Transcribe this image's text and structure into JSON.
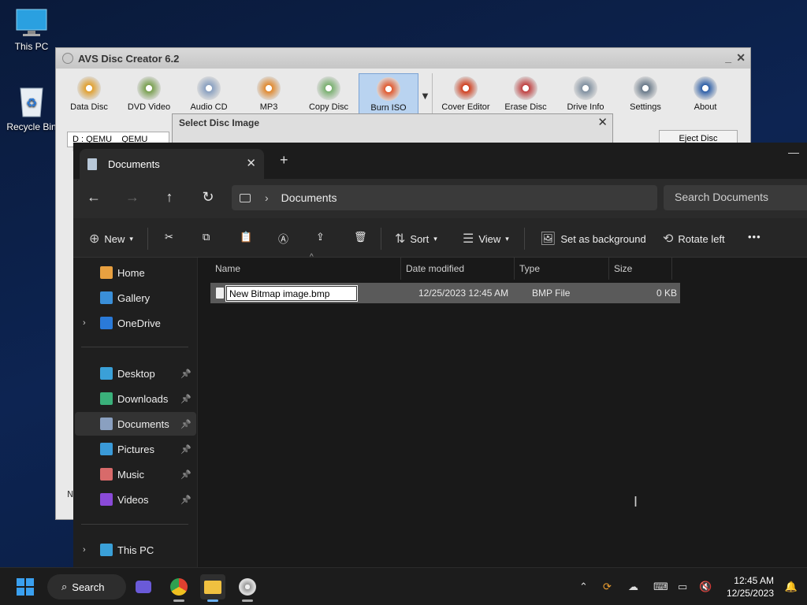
{
  "desktop": {
    "icons": [
      {
        "label": "This PC"
      },
      {
        "label": "Recycle Bin"
      }
    ]
  },
  "avs": {
    "title": "AVS Disc Creator 6.2",
    "toolbar": [
      {
        "label": "Data Disc",
        "icon": "data-disc-icon",
        "color": "#e0a030"
      },
      {
        "label": "DVD Video",
        "icon": "dvd-video-icon",
        "color": "#7aa050"
      },
      {
        "label": "Audio CD",
        "icon": "audio-cd-icon",
        "color": "#8aa0c0"
      },
      {
        "label": "MP3",
        "icon": "mp3-icon",
        "color": "#e08a30"
      },
      {
        "label": "Copy Disc",
        "icon": "copy-disc-icon",
        "color": "#7ab070"
      },
      {
        "label": "Burn ISO",
        "icon": "burn-iso-icon",
        "color": "#e05a30"
      },
      {
        "label": "Cover Editor",
        "icon": "cover-editor-icon",
        "color": "#d04020"
      },
      {
        "label": "Erase Disc",
        "icon": "erase-disc-icon",
        "color": "#c04040"
      },
      {
        "label": "Drive Info",
        "icon": "drive-info-icon",
        "color": "#8090a0"
      },
      {
        "label": "Settings",
        "icon": "gear-icon",
        "color": "#6a7a8a"
      },
      {
        "label": "About",
        "icon": "question-icon",
        "color": "#2d5fa8"
      }
    ],
    "drive": "D : QEMU",
    "drive_model": "QEMU DVD",
    "eject": "Eject Disc",
    "side_label": "N"
  },
  "dialog": {
    "title": "Select Disc Image"
  },
  "explorer": {
    "tab_title": "Documents",
    "address": "Documents",
    "search_placeholder": "Search Documents",
    "commands": {
      "new": "New",
      "sort": "Sort",
      "view": "View",
      "set_bg": "Set as background",
      "rotate": "Rotate left"
    },
    "nav": [
      {
        "label": "Home",
        "color": "#e8a040"
      },
      {
        "label": "Gallery",
        "color": "#3a8fd8"
      },
      {
        "label": "OneDrive",
        "color": "#2a7ad8"
      },
      {
        "label": "Desktop",
        "color": "#3aa0d8"
      },
      {
        "label": "Downloads",
        "color": "#3ab07a"
      },
      {
        "label": "Documents",
        "color": "#8aa0c0"
      },
      {
        "label": "Pictures",
        "color": "#3a9ad8"
      },
      {
        "label": "Music",
        "color": "#d86a6a"
      },
      {
        "label": "Videos",
        "color": "#8a4ad8"
      },
      {
        "label": "This PC",
        "color": "#3aa0d8"
      }
    ],
    "columns": {
      "name": "Name",
      "date": "Date modified",
      "type": "Type",
      "size": "Size"
    },
    "files": [
      {
        "name": "New Bitmap image.bmp",
        "date": "12/25/2023 12:45 AM",
        "type": "BMP File",
        "size": "0 KB"
      }
    ]
  },
  "taskbar": {
    "search": "Search",
    "time": "12:45 AM",
    "date": "12/25/2023"
  }
}
